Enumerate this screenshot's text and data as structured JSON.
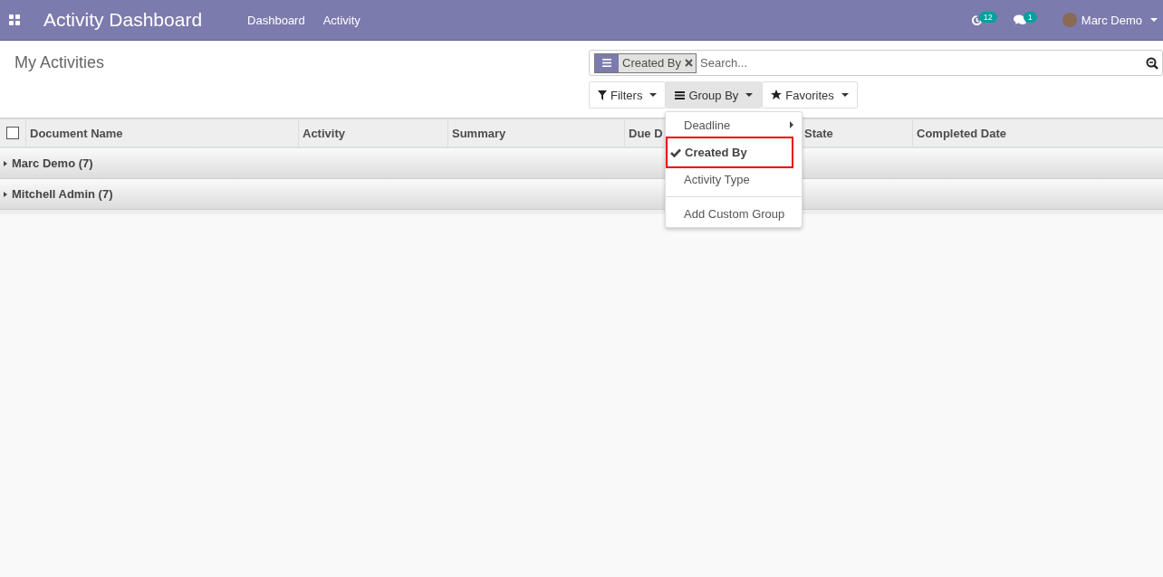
{
  "navbar": {
    "app_title": "Activity Dashboard",
    "menu": [
      "Dashboard",
      "Activity"
    ],
    "activity_count": "12",
    "message_count": "1",
    "user": "Marc Demo"
  },
  "control_panel": {
    "title": "My Activities",
    "search": {
      "facet": "Created By",
      "placeholder": "Search..."
    },
    "buttons": [
      {
        "kind": "filter",
        "label": "Filters",
        "selected": false
      },
      {
        "kind": "group",
        "label": "Group By",
        "selected": true
      },
      {
        "kind": "star",
        "label": "Favorites",
        "selected": false
      }
    ]
  },
  "group_by_menu": {
    "items": [
      {
        "kind": "submenu",
        "label": "Deadline",
        "selected": false,
        "highlighted": false
      },
      {
        "kind": "option",
        "label": "Created By",
        "selected": true,
        "highlighted": true
      },
      {
        "kind": "option",
        "label": "Activity Type",
        "selected": false,
        "highlighted": false
      },
      {
        "kind": "divider"
      },
      {
        "kind": "option",
        "label": "Add Custom Group",
        "selected": false,
        "highlighted": false
      }
    ]
  },
  "table": {
    "select_all": {
      "checked": false
    },
    "columns": [
      "Document Name",
      "Activity",
      "Summary",
      "Due D",
      "State",
      "Completed Date"
    ],
    "groups": [
      {
        "label": "Marc Demo (7)",
        "expanded": false
      },
      {
        "label": "Mitchell Admin (7)",
        "expanded": false
      }
    ]
  }
}
